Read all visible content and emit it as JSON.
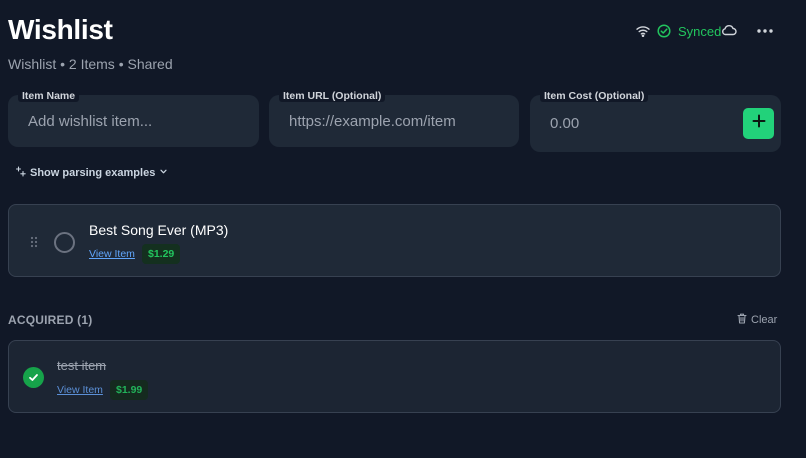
{
  "header": {
    "title": "Wishlist",
    "subtitle": "Wishlist • 2 Items • Shared",
    "sync_status": "Synced",
    "icons": [
      "wifi-icon",
      "check-circle-icon",
      "cloud-icon",
      "more-icon"
    ]
  },
  "form": {
    "name_label": "Item Name",
    "name_placeholder": "Add wishlist item...",
    "url_label": "Item URL (Optional)",
    "url_placeholder": "https://example.com/item",
    "cost_label": "Item Cost (Optional)",
    "cost_placeholder": "0.00"
  },
  "parsing_examples_label": "Show parsing examples",
  "items": [
    {
      "title": "Best Song Ever (MP3)",
      "link_label": "View Item",
      "price": "$1.29"
    }
  ],
  "acquired": {
    "heading": "ACQUIRED (1)",
    "clear_label": "Clear",
    "items": [
      {
        "title": "test item",
        "link_label": "View Item",
        "price": "$1.99"
      }
    ]
  },
  "colors": {
    "background": "#111827",
    "card": "#1f2937",
    "accent": "#22d27a",
    "success": "#22c55e",
    "link": "#60a5fa"
  }
}
